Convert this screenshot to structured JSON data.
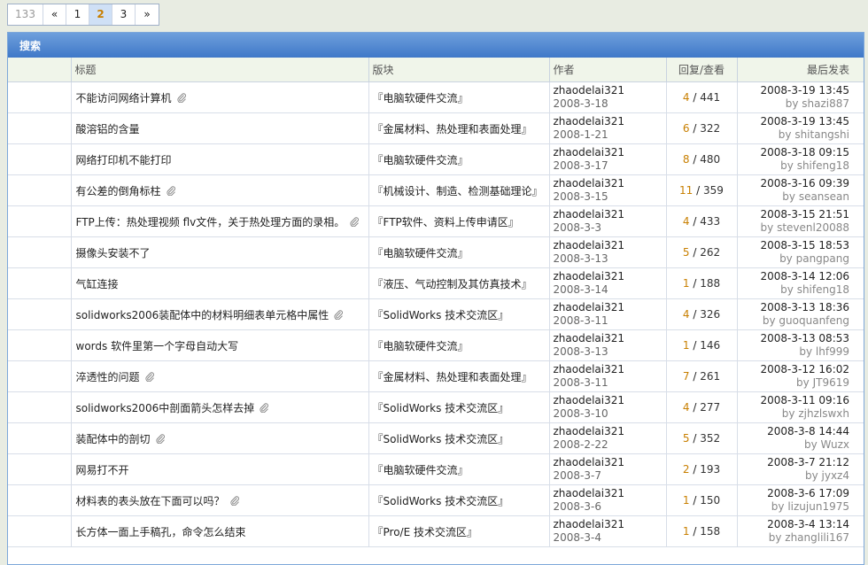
{
  "pager": {
    "total": "133",
    "prev": "«",
    "pages": [
      "1",
      "2",
      "3"
    ],
    "current": "2",
    "next": "»"
  },
  "panel": {
    "title": "搜索"
  },
  "columns": {
    "topic": "标题",
    "forum": "版块",
    "author": "作者",
    "stats": "回复/查看",
    "last": "最后发表"
  },
  "rows": [
    {
      "title": "不能访问网络计算机",
      "attach": true,
      "forum": "『电脑软硬件交流』",
      "author": "zhaodelai321",
      "date": "2008-3-18",
      "replies": "4",
      "views": "441",
      "last_time": "2008-3-19 13:45",
      "last_by": "shazi887"
    },
    {
      "title": "酸溶铝的含量",
      "attach": false,
      "forum": "『金属材料、热处理和表面处理』",
      "author": "zhaodelai321",
      "date": "2008-1-21",
      "replies": "6",
      "views": "322",
      "last_time": "2008-3-19 13:45",
      "last_by": "shitangshi"
    },
    {
      "title": "网络打印机不能打印",
      "attach": false,
      "forum": "『电脑软硬件交流』",
      "author": "zhaodelai321",
      "date": "2008-3-17",
      "replies": "8",
      "views": "480",
      "last_time": "2008-3-18 09:15",
      "last_by": "shifeng18"
    },
    {
      "title": "有公差的倒角标柱",
      "attach": true,
      "forum": "『机械设计、制造、检测基础理论』",
      "author": "zhaodelai321",
      "date": "2008-3-15",
      "replies": "11",
      "views": "359",
      "last_time": "2008-3-16 09:39",
      "last_by": "seansean"
    },
    {
      "title": "FTP上传：热处理视频 flv文件，关于热处理方面的录相。",
      "attach": true,
      "forum": "『FTP软件、资料上传申请区』",
      "author": "zhaodelai321",
      "date": "2008-3-3",
      "replies": "4",
      "views": "433",
      "last_time": "2008-3-15 21:51",
      "last_by": "stevenl20088"
    },
    {
      "title": "摄像头安装不了",
      "attach": false,
      "forum": "『电脑软硬件交流』",
      "author": "zhaodelai321",
      "date": "2008-3-13",
      "replies": "5",
      "views": "262",
      "last_time": "2008-3-15 18:53",
      "last_by": "pangpang"
    },
    {
      "title": "气缸连接",
      "attach": false,
      "forum": "『液压、气动控制及其仿真技术』",
      "author": "zhaodelai321",
      "date": "2008-3-14",
      "replies": "1",
      "views": "188",
      "last_time": "2008-3-14 12:06",
      "last_by": "shifeng18"
    },
    {
      "title": "solidworks2006装配体中的材料明细表单元格中属性",
      "attach": true,
      "forum": "『SolidWorks 技术交流区』",
      "author": "zhaodelai321",
      "date": "2008-3-11",
      "replies": "4",
      "views": "326",
      "last_time": "2008-3-13 18:36",
      "last_by": "guoquanfeng"
    },
    {
      "title": "words 软件里第一个字母自动大写",
      "attach": false,
      "forum": "『电脑软硬件交流』",
      "author": "zhaodelai321",
      "date": "2008-3-13",
      "replies": "1",
      "views": "146",
      "last_time": "2008-3-13 08:53",
      "last_by": "lhf999"
    },
    {
      "title": "淬透性的问题",
      "attach": true,
      "forum": "『金属材料、热处理和表面处理』",
      "author": "zhaodelai321",
      "date": "2008-3-11",
      "replies": "7",
      "views": "261",
      "last_time": "2008-3-12 16:02",
      "last_by": "JT9619"
    },
    {
      "title": "solidworks2006中剖面箭头怎样去掉",
      "attach": true,
      "forum": "『SolidWorks 技术交流区』",
      "author": "zhaodelai321",
      "date": "2008-3-10",
      "replies": "4",
      "views": "277",
      "last_time": "2008-3-11 09:16",
      "last_by": "zjhzlswxh"
    },
    {
      "title": "装配体中的剖切",
      "attach": true,
      "forum": "『SolidWorks 技术交流区』",
      "author": "zhaodelai321",
      "date": "2008-2-22",
      "replies": "5",
      "views": "352",
      "last_time": "2008-3-8 14:44",
      "last_by": "Wuzx"
    },
    {
      "title": "网易打不开",
      "attach": false,
      "forum": "『电脑软硬件交流』",
      "author": "zhaodelai321",
      "date": "2008-3-7",
      "replies": "2",
      "views": "193",
      "last_time": "2008-3-7 21:12",
      "last_by": "jyxz4"
    },
    {
      "title": "材料表的表头放在下面可以吗？",
      "attach": true,
      "forum": "『SolidWorks 技术交流区』",
      "author": "zhaodelai321",
      "date": "2008-3-6",
      "replies": "1",
      "views": "150",
      "last_time": "2008-3-6 17:09",
      "last_by": "lizujun1975"
    },
    {
      "title": "长方体一面上手稿孔，命令怎么结束",
      "attach": false,
      "forum": "『Pro/E 技术交流区』",
      "author": "zhaodelai321",
      "date": "2008-3-4",
      "replies": "1",
      "views": "158",
      "last_time": "2008-3-4 13:14",
      "last_by": "zhanglili167"
    }
  ],
  "labels": {
    "by": "by",
    "sep": "/"
  }
}
